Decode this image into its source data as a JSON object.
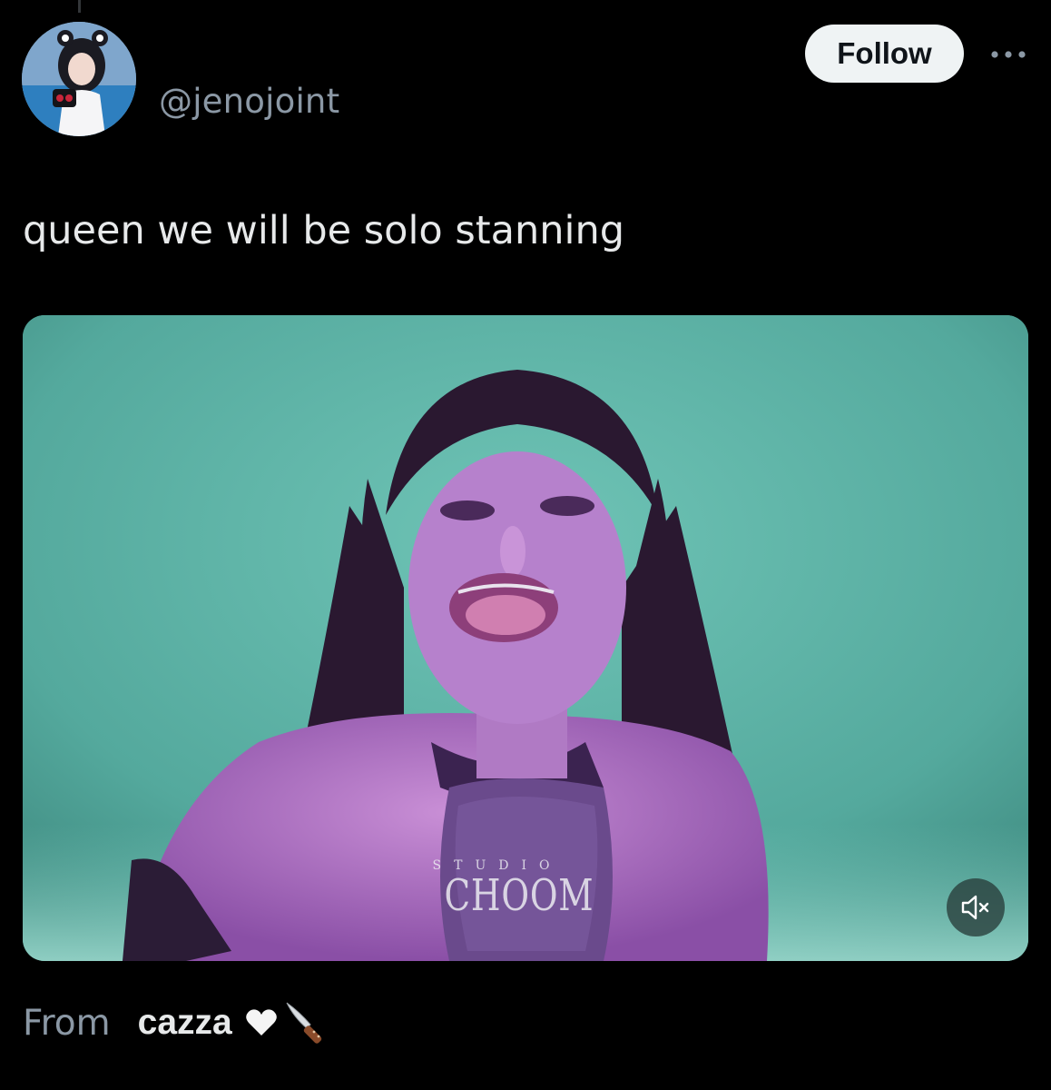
{
  "post": {
    "handle": "@jenojoint",
    "follow_label": "Follow",
    "text": "queen we will be solo stanning"
  },
  "media": {
    "watermark_top": "STUDIO",
    "watermark_main": "CHOOM"
  },
  "community_note": {
    "from_label": "From",
    "source_name": "cazza"
  },
  "icons": {
    "more": "more-horizontal-icon",
    "mute": "volume-muted-icon",
    "heart": "white-heart-emoji",
    "knife": "kitchen-knife-emoji"
  },
  "colors": {
    "background": "#000000",
    "text_primary": "#e7e9ea",
    "text_secondary": "#8b98a5",
    "follow_bg": "#eff3f4",
    "media_bg": "#5bb3a6"
  }
}
